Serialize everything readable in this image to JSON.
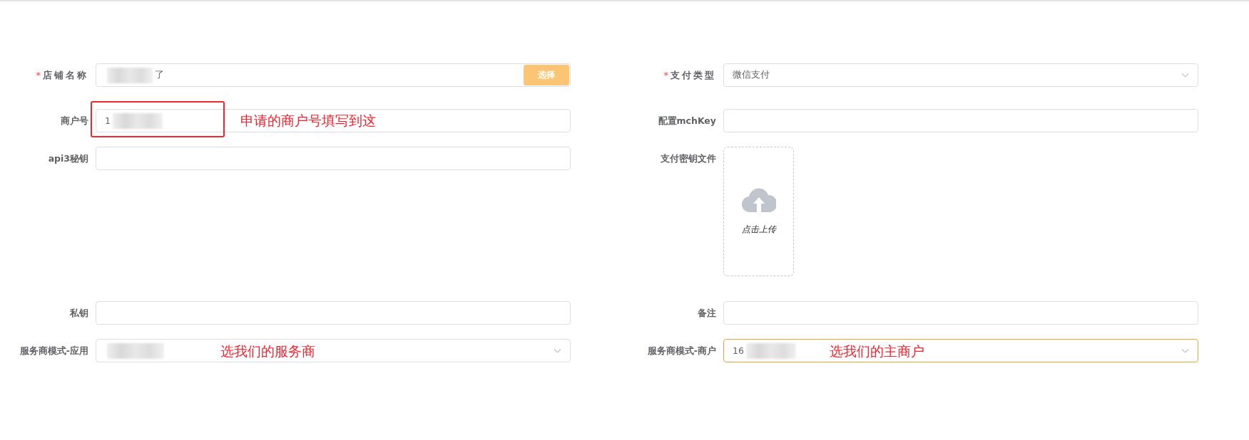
{
  "left_fields": [
    {
      "kind": "input_button",
      "label": "店铺名称",
      "required_mark": "*",
      "value": "了",
      "blurred": true,
      "button": "选择"
    },
    {
      "kind": "input",
      "label": "商户号",
      "value": "1",
      "blurred": true,
      "highlighted": true,
      "note": "申请的商户号填写到这"
    },
    {
      "kind": "input",
      "label": "api3秘钥"
    },
    {
      "kind": "spacer"
    },
    {
      "kind": "input",
      "label": "私钥"
    },
    {
      "kind": "select",
      "label": "服务商模式-应用",
      "blurred": true,
      "focused": false,
      "note": "选我们的服务商"
    }
  ],
  "right_fields": [
    {
      "kind": "select",
      "label": "支付类型",
      "required_mark": "*",
      "value": "微信支付",
      "focused": false
    },
    {
      "kind": "input",
      "label": "配置mchKey"
    },
    {
      "kind": "upload",
      "label": "支付密钥文件",
      "hint": "点击上传"
    },
    {
      "kind": "input",
      "label": "备注"
    },
    {
      "kind": "select",
      "label": "服务商模式-商户",
      "value": "16",
      "blurred": true,
      "focused": true,
      "note": "选我们的主商户"
    }
  ]
}
